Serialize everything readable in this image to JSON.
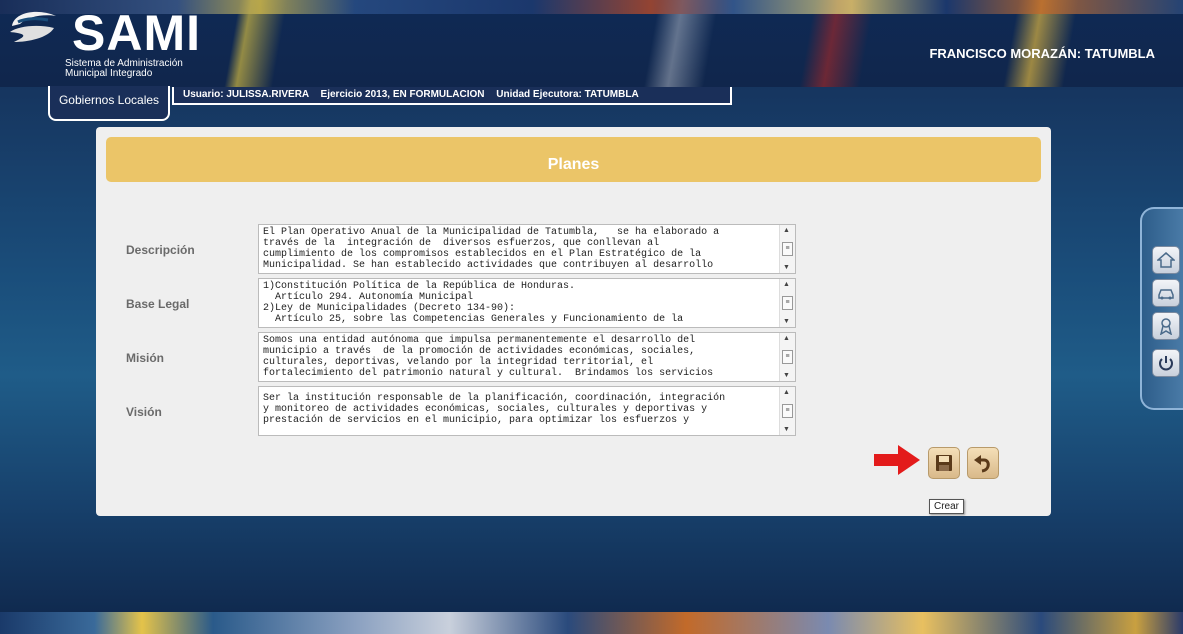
{
  "header": {
    "logo_title": "SAMI",
    "logo_subtitle_line1": "Sistema de Administración",
    "logo_subtitle_line2": "Municipal Integrado",
    "municipality": "FRANCISCO MORAZÁN: TATUMBLA"
  },
  "tab": {
    "label": "Gobiernos Locales"
  },
  "infobar": {
    "usuario": "Usuario: JULISSA.RIVERA",
    "ejercicio": "Ejercicio 2013, EN FORMULACION",
    "unidad": "Unidad Ejecutora: TATUMBLA"
  },
  "panel": {
    "title": "Planes"
  },
  "form": {
    "descripcion": {
      "label": "Descripción",
      "value": "El Plan Operativo Anual de la Municipalidad de Tatumbla,   se ha elaborado a\ntravés de la  integración de  diversos esfuerzos, que conllevan al\ncumplimiento de los compromisos establecidos en el Plan Estratégico de la\nMunicipalidad. Se han establecido actividades que contribuyen al desarrollo"
    },
    "base_legal": {
      "label": "Base Legal",
      "value": "1)Constitución Política de la República de Honduras.\n  Artículo 294. Autonomía Municipal\n2)Ley de Municipalidades (Decreto 134-90):\n  Artículo 25, sobre las Competencias Generales y Funcionamiento de la"
    },
    "mision": {
      "label": "Misión",
      "value": "Somos una entidad autónoma que impulsa permanentemente el desarrollo del\nmunicipio a través  de la promoción de actividades económicas, sociales,\nculturales, deportivas, velando por la integridad territorial, el\nfortalecimiento del patrimonio natural y cultural.  Brindamos los servicios"
    },
    "vision": {
      "label": "Visión",
      "value": "Ser la institución responsable de la planificación, coordinación, integración\ny monitoreo de actividades económicas, sociales, culturales y deportivas y\nprestación de servicios en el municipio, para optimizar los esfuerzos y"
    }
  },
  "actions": {
    "save_icon": "floppy-disk-icon",
    "undo_icon": "undo-arrow-icon",
    "tooltip": "Crear"
  },
  "sidenav": {
    "icons": [
      "home-icon",
      "car-icon",
      "award-ribbon-icon",
      "power-icon"
    ]
  },
  "colors": {
    "header_bg": "#10264c",
    "panel_header": "#ebc568",
    "panel_bg": "#efefef",
    "arrow": "#e31b1b"
  }
}
